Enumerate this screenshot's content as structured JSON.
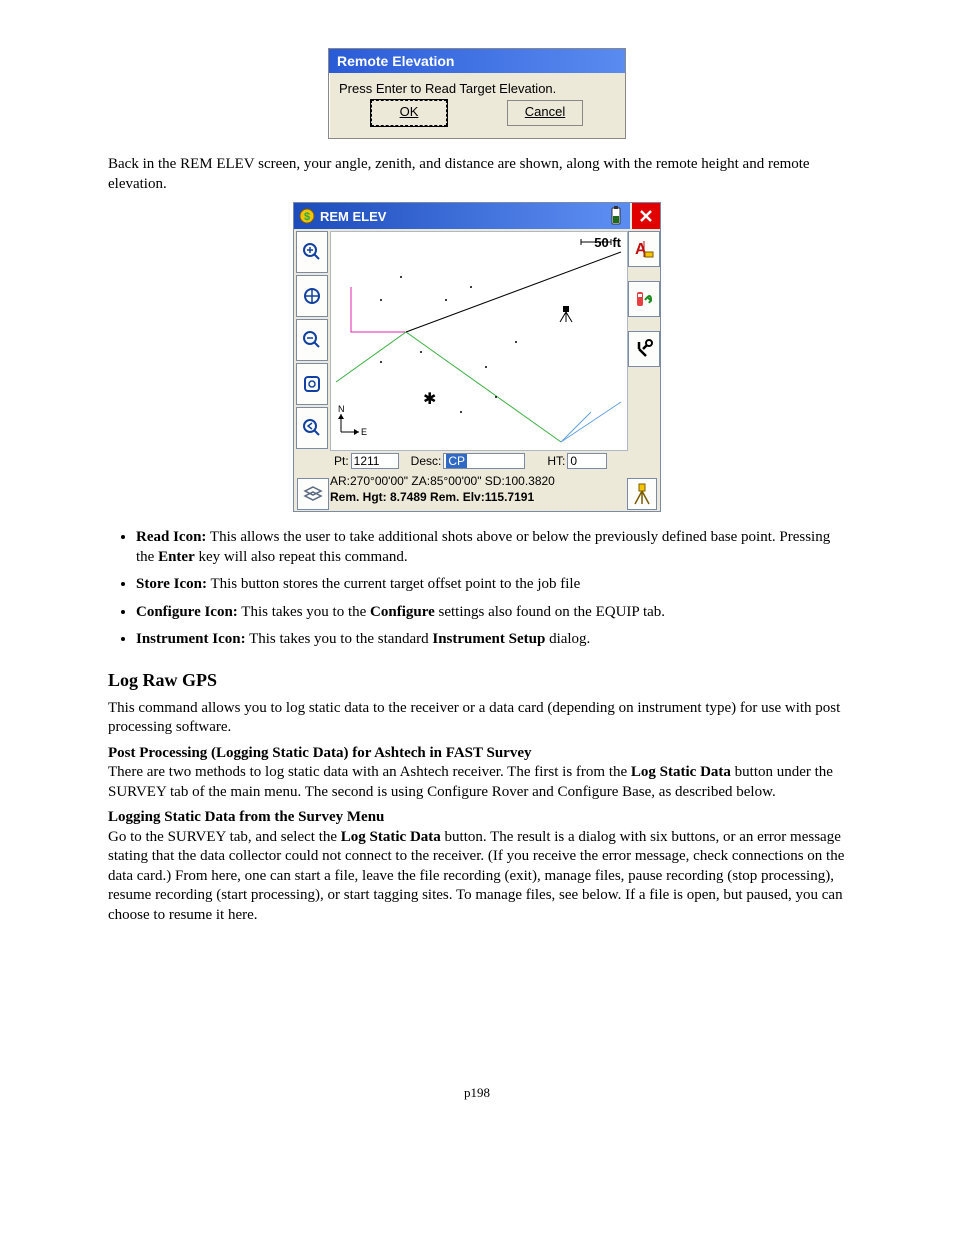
{
  "dialog1": {
    "title": "Remote Elevation",
    "prompt": "Press Enter to Read Target Elevation.",
    "ok": "OK",
    "cancel": "Cancel"
  },
  "para1": "Back in the REM ELEV screen, your angle, zenith, and distance are shown, along with the remote height and remote elevation.",
  "rem": {
    "title": "REM ELEV",
    "scale": "50 ft",
    "pt_label": "Pt:",
    "pt_value": "1211",
    "desc_label": "Desc:",
    "desc_value": "CP",
    "ht_label": "HT:",
    "ht_value": "0",
    "status1": "AR:270°00'00\"  ZA:85°00'00\"    SD:100.3820",
    "status2_a": "Rem. Hgt: 8.7489 Rem. Elv:115.7191"
  },
  "bullets": {
    "b1_label": "Read Icon:",
    "b1_text": " This allows the user to take additional shots above or below the previously defined base point. Pressing the ",
    "b1_bold": "Enter",
    "b1_text2": " key will also repeat this command.",
    "b2_label": "Store Icon:",
    "b2_text": " This button stores the current target offset point to the job file",
    "b3_label": "Configure Icon:",
    "b3_text_a": " This takes you to the ",
    "b3_bold": "Configure",
    "b3_text_b": " settings also found on the EQUIP tab.",
    "b4_label": "Instrument Icon:",
    "b4_text_a": " This takes you to the standard ",
    "b4_bold": "Instrument Setup",
    "b4_text_b": " dialog."
  },
  "section_h": "Log Raw GPS",
  "section_p1": "This command allows you to log static data to the receiver or a data card (depending on instrument type) for use with post processing software.",
  "section_h2": "Post Processing (Logging Static Data) for Ashtech in FAST Survey",
  "section_p2a": "There are two methods to log static data with an Ashtech receiver. The first is from the ",
  "section_p2_bold": "Log Static Data",
  "section_p2b": " button under the SURVEY tab of the main menu. The second is using Configure Rover and Configure Base, as described below.",
  "section_h3": "Logging Static Data from the Survey Menu",
  "section_p3a": "Go to the SURVEY tab, and select the ",
  "section_p3_bold": "Log Static Data",
  "section_p3b": " button. The result is a dialog with six buttons, or an error message stating that the data collector could not connect to the receiver. (If you  receive the error message, check connections on the data card.) From here, one can start a file, leave the file recording (exit), manage files, pause recording (stop processing), resume recording (start processing), or start tagging sites. To manage files, see below. If a file is open, but paused, you can choose to resume it here.",
  "page_num": "p198"
}
